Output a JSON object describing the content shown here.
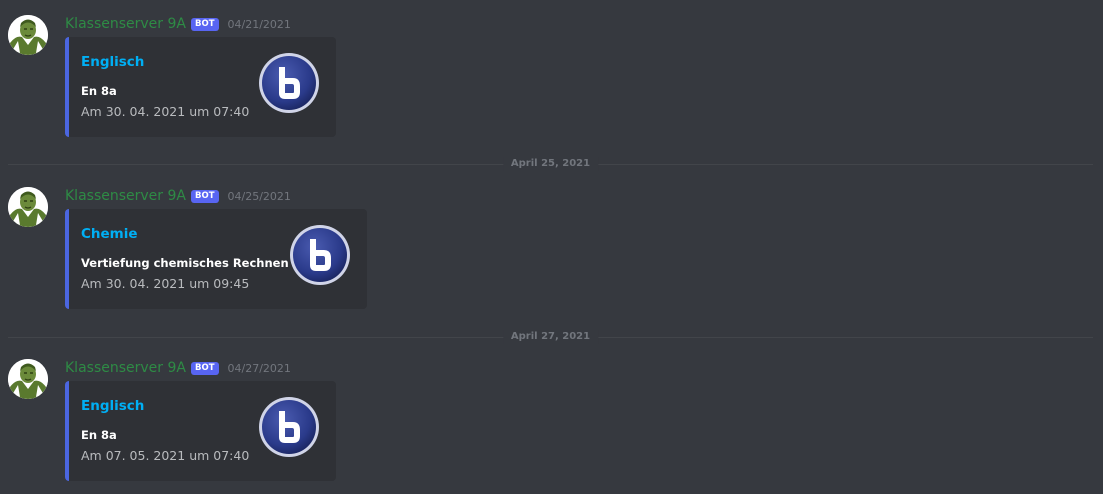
{
  "messages": [
    {
      "username": "Klassenserver 9A",
      "bot_tag": "BOT",
      "timestamp": "04/21/2021",
      "embed": {
        "title": "Englisch",
        "field_name": "En 8a",
        "field_value": "Am 30. 04. 2021 um 07:40"
      }
    },
    {
      "username": "Klassenserver 9A",
      "bot_tag": "BOT",
      "timestamp": "04/25/2021",
      "embed": {
        "title": "Chemie",
        "field_name": "Vertiefung chemisches Rechnen",
        "field_value": "Am 30. 04. 2021 um 09:45"
      }
    },
    {
      "username": "Klassenserver 9A",
      "bot_tag": "BOT",
      "timestamp": "04/27/2021",
      "embed": {
        "title": "Englisch",
        "field_name": "En 8a",
        "field_value": "Am 07. 05. 2021 um 07:40"
      }
    }
  ],
  "dividers": [
    {
      "label": "April 25, 2021"
    },
    {
      "label": "April 27, 2021"
    }
  ],
  "colors": {
    "background": "#36393f",
    "embed_background": "#2f3136",
    "embed_border": "#4b66e0",
    "username": "#2e8b45",
    "embed_title": "#00aff4",
    "bot_tag": "#5865f2"
  },
  "icons": {
    "avatar": "server-avatar-icon",
    "thumbnail": "bigbluebutton-logo-icon"
  }
}
